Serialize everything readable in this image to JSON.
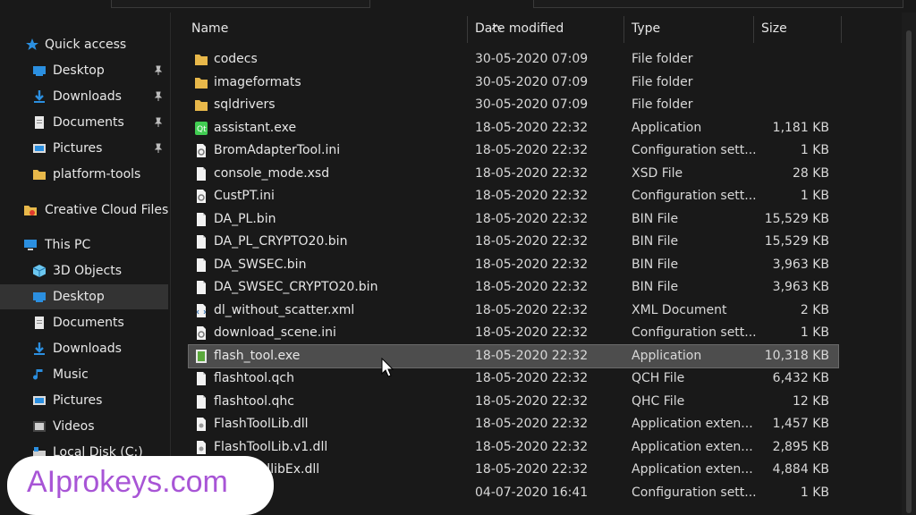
{
  "sidebar": {
    "quick_access": "Quick access",
    "items": [
      {
        "label": "Desktop",
        "icon": "desktop-folder-icon",
        "pinned": true
      },
      {
        "label": "Downloads",
        "icon": "downloads-folder-icon",
        "pinned": true
      },
      {
        "label": "Documents",
        "icon": "documents-folder-icon",
        "pinned": true
      },
      {
        "label": "Pictures",
        "icon": "pictures-folder-icon",
        "pinned": true
      },
      {
        "label": "platform-tools",
        "icon": "folder-icon",
        "pinned": false
      }
    ],
    "creative_cloud": "Creative Cloud Files",
    "this_pc": "This PC",
    "pc_items": [
      {
        "label": "3D Objects",
        "icon": "3d-objects-icon"
      },
      {
        "label": "Desktop",
        "icon": "desktop-folder-icon",
        "selected": true
      },
      {
        "label": "Documents",
        "icon": "documents-folder-icon"
      },
      {
        "label": "Downloads",
        "icon": "downloads-folder-icon"
      },
      {
        "label": "Music",
        "icon": "music-icon"
      },
      {
        "label": "Pictures",
        "icon": "pictures-folder-icon"
      },
      {
        "label": "Videos",
        "icon": "videos-icon"
      },
      {
        "label": "Local Disk (C:)",
        "icon": "local-disk-icon"
      }
    ]
  },
  "columns": {
    "name": "Name",
    "date": "Date modified",
    "type": "Type",
    "size": "Size"
  },
  "files": [
    {
      "name": "codecs",
      "date": "30-05-2020 07:09",
      "type": "File folder",
      "size": "",
      "icon": "folder"
    },
    {
      "name": "imageformats",
      "date": "30-05-2020 07:09",
      "type": "File folder",
      "size": "",
      "icon": "folder"
    },
    {
      "name": "sqldrivers",
      "date": "30-05-2020 07:09",
      "type": "File folder",
      "size": "",
      "icon": "folder"
    },
    {
      "name": "assistant.exe",
      "date": "18-05-2020 22:32",
      "type": "Application",
      "size": "1,181 KB",
      "icon": "qt-app"
    },
    {
      "name": "BromAdapterTool.ini",
      "date": "18-05-2020 22:32",
      "type": "Configuration sett...",
      "size": "1 KB",
      "icon": "config"
    },
    {
      "name": "console_mode.xsd",
      "date": "18-05-2020 22:32",
      "type": "XSD File",
      "size": "28 KB",
      "icon": "file"
    },
    {
      "name": "CustPT.ini",
      "date": "18-05-2020 22:32",
      "type": "Configuration sett...",
      "size": "1 KB",
      "icon": "config"
    },
    {
      "name": "DA_PL.bin",
      "date": "18-05-2020 22:32",
      "type": "BIN File",
      "size": "15,529 KB",
      "icon": "file"
    },
    {
      "name": "DA_PL_CRYPTO20.bin",
      "date": "18-05-2020 22:32",
      "type": "BIN File",
      "size": "15,529 KB",
      "icon": "file"
    },
    {
      "name": "DA_SWSEC.bin",
      "date": "18-05-2020 22:32",
      "type": "BIN File",
      "size": "3,963 KB",
      "icon": "file"
    },
    {
      "name": "DA_SWSEC_CRYPTO20.bin",
      "date": "18-05-2020 22:32",
      "type": "BIN File",
      "size": "3,963 KB",
      "icon": "file"
    },
    {
      "name": "dl_without_scatter.xml",
      "date": "18-05-2020 22:32",
      "type": "XML Document",
      "size": "2 KB",
      "icon": "xml"
    },
    {
      "name": "download_scene.ini",
      "date": "18-05-2020 22:32",
      "type": "Configuration sett...",
      "size": "1 KB",
      "icon": "config"
    },
    {
      "name": "flash_tool.exe",
      "date": "18-05-2020 22:32",
      "type": "Application",
      "size": "10,318 KB",
      "icon": "flash-app",
      "selected": true
    },
    {
      "name": "flashtool.qch",
      "date": "18-05-2020 22:32",
      "type": "QCH File",
      "size": "6,432 KB",
      "icon": "file"
    },
    {
      "name": "flashtool.qhc",
      "date": "18-05-2020 22:32",
      "type": "QHC File",
      "size": "12 KB",
      "icon": "file"
    },
    {
      "name": "FlashToolLib.dll",
      "date": "18-05-2020 22:32",
      "type": "Application exten...",
      "size": "1,457 KB",
      "icon": "dll"
    },
    {
      "name": "FlashToolLib.v1.dll",
      "date": "18-05-2020 22:32",
      "type": "Application exten...",
      "size": "2,895 KB",
      "icon": "dll"
    },
    {
      "name": "FlashtoollibEx.dll",
      "date": "18-05-2020 22:32",
      "type": "Application exten...",
      "size": "4,884 KB",
      "icon": "dll"
    },
    {
      "name": "",
      "date": "04-07-2020 16:41",
      "type": "Configuration sett...",
      "size": "1 KB",
      "icon": "config"
    }
  ],
  "watermark": "AIprokeys.com",
  "colors": {
    "folder": "#e8b84a",
    "selection": "#4d4d4d",
    "accent": "#2b8fe0",
    "watermark": "#a855d6"
  }
}
